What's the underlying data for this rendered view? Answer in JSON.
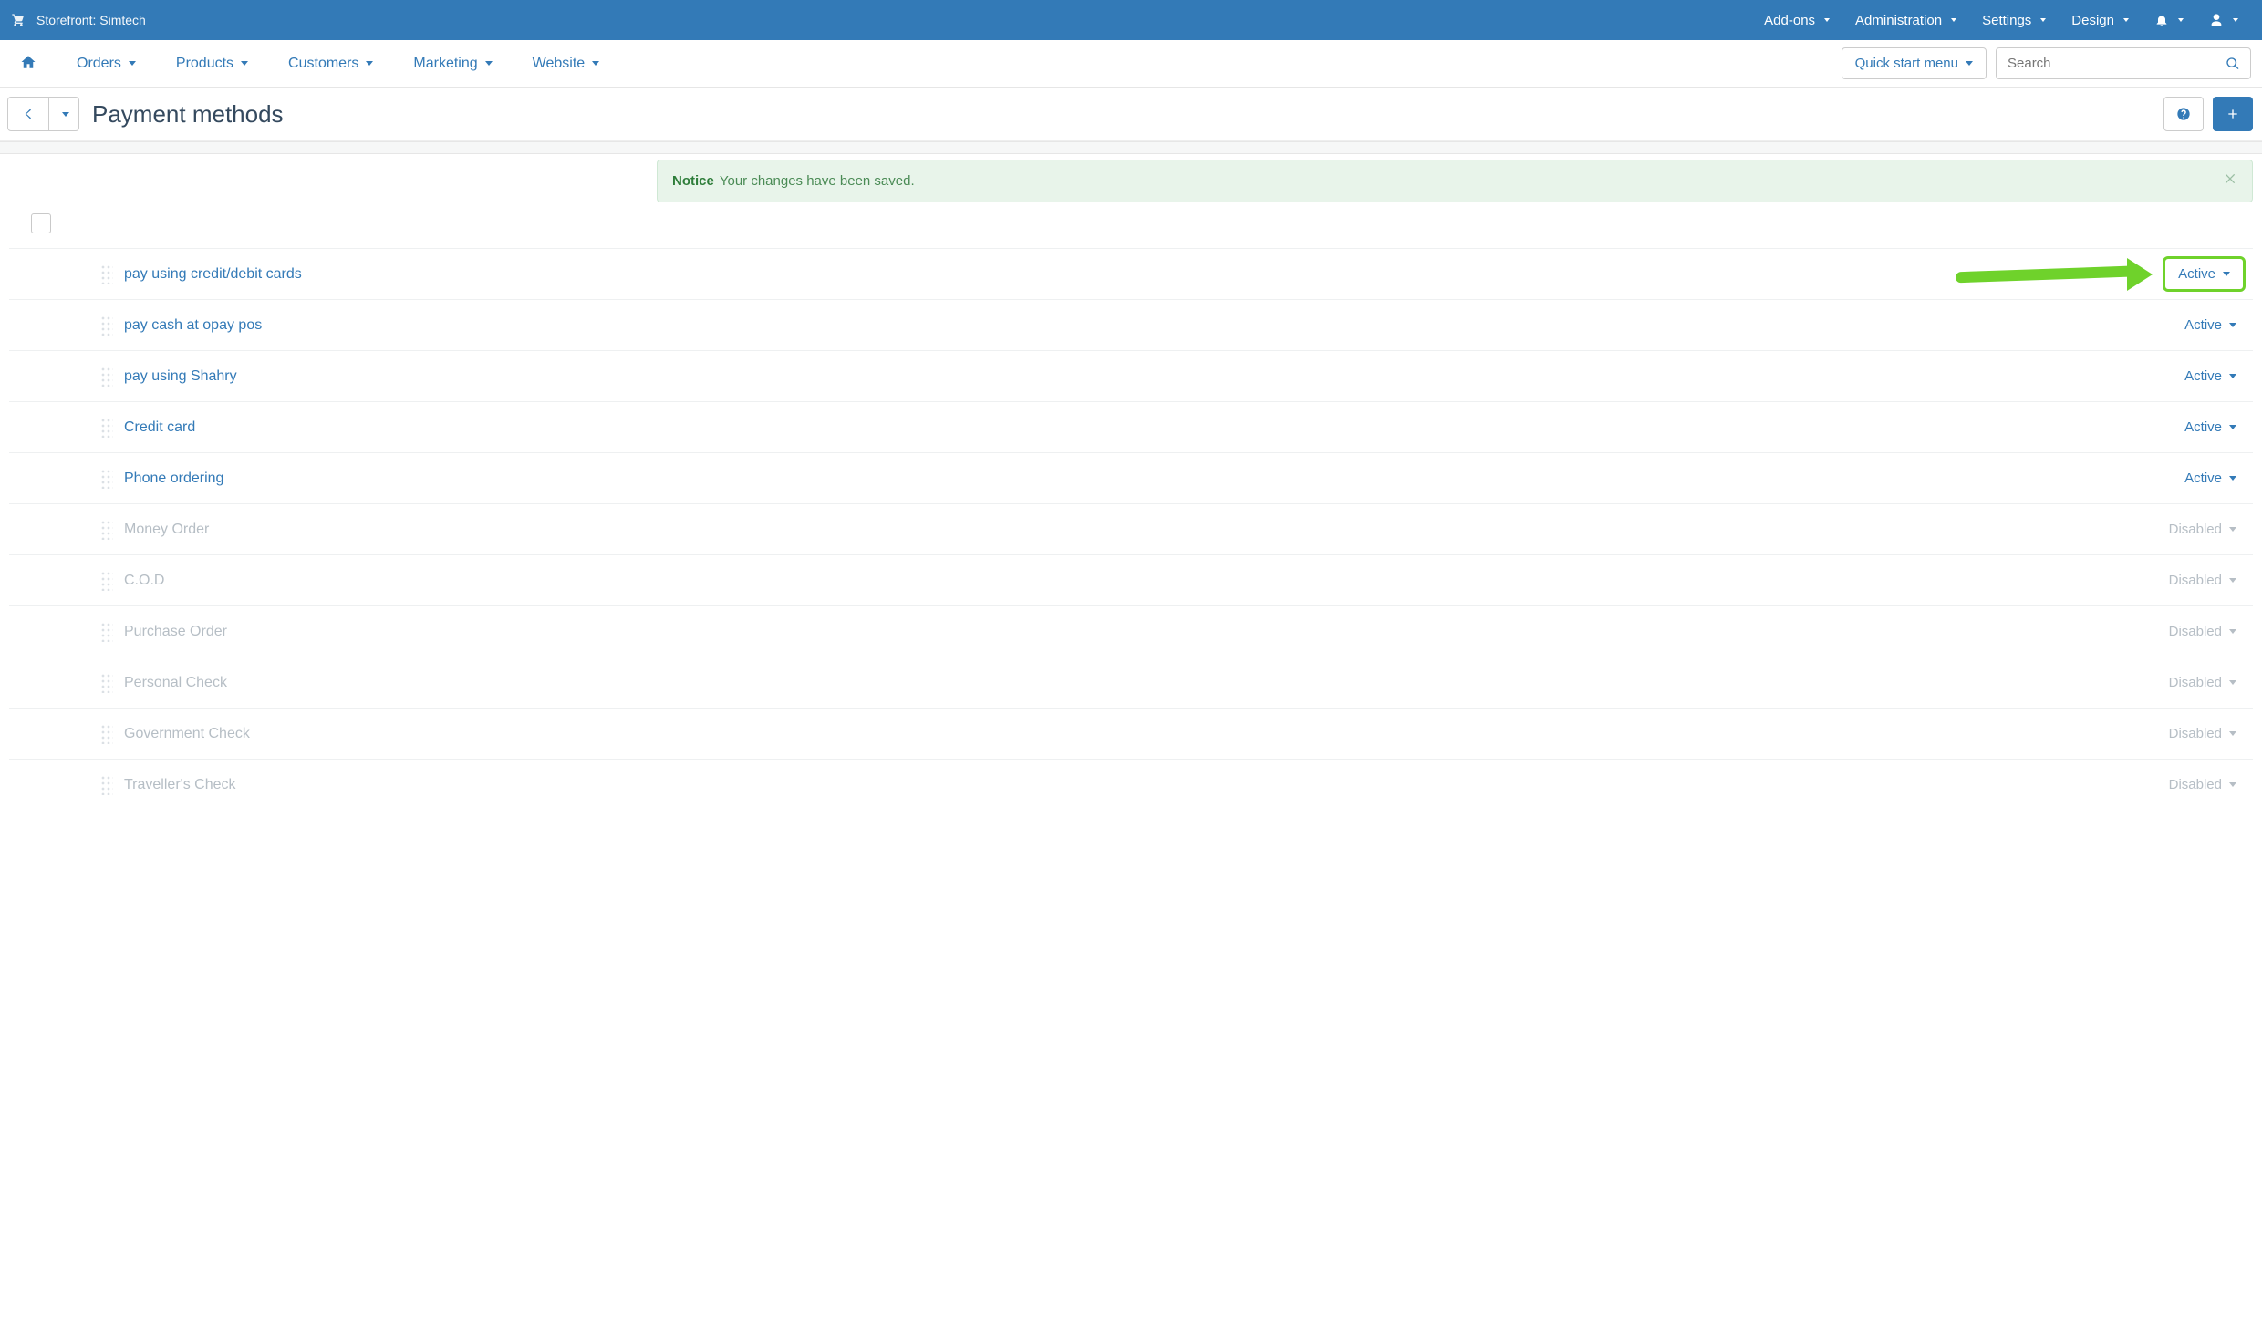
{
  "topbar": {
    "storefront_prefix": "Storefront:",
    "storefront_name": "Simtech",
    "right": {
      "addons": "Add-ons",
      "administration": "Administration",
      "settings": "Settings",
      "design": "Design"
    }
  },
  "nav": {
    "orders": "Orders",
    "products": "Products",
    "customers": "Customers",
    "marketing": "Marketing",
    "website": "Website",
    "quick_start": "Quick start menu",
    "search_placeholder": "Search"
  },
  "page": {
    "title": "Payment methods"
  },
  "notice": {
    "label": "Notice",
    "text": "Your changes have been saved."
  },
  "status_labels": {
    "active": "Active",
    "disabled": "Disabled"
  },
  "rows": [
    {
      "name": "pay using credit/debit cards",
      "status": "active",
      "highlight": true
    },
    {
      "name": "pay cash at opay pos",
      "status": "active",
      "highlight": false
    },
    {
      "name": "pay using Shahry",
      "status": "active",
      "highlight": false
    },
    {
      "name": "Credit card",
      "status": "active",
      "highlight": false
    },
    {
      "name": "Phone ordering",
      "status": "active",
      "highlight": false
    },
    {
      "name": "Money Order",
      "status": "disabled",
      "highlight": false
    },
    {
      "name": "C.O.D",
      "status": "disabled",
      "highlight": false
    },
    {
      "name": "Purchase Order",
      "status": "disabled",
      "highlight": false
    },
    {
      "name": "Personal Check",
      "status": "disabled",
      "highlight": false
    },
    {
      "name": "Government Check",
      "status": "disabled",
      "highlight": false
    },
    {
      "name": "Traveller's Check",
      "status": "disabled",
      "highlight": false
    }
  ]
}
